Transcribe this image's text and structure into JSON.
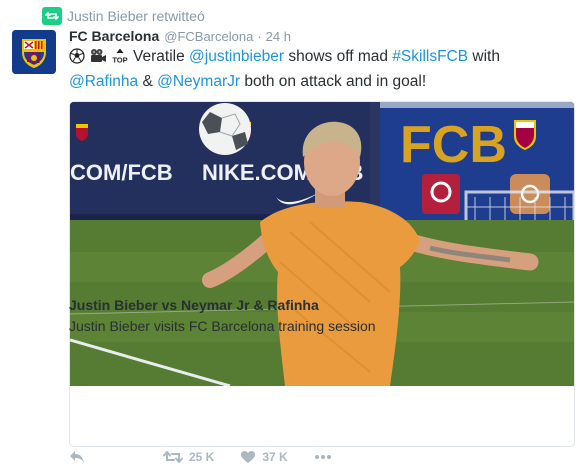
{
  "retweet": {
    "label": "Justin Bieber retwitteó"
  },
  "tweet": {
    "name": "FC Barcelona",
    "handle": "@FCBarcelona",
    "separator": "·",
    "time": "24 h",
    "emojis": [
      "soccer-ball-icon",
      "movie-camera-icon",
      "top-arrow-icon"
    ],
    "top_glyph": "TOP",
    "text_parts": {
      "p1": "Veratile ",
      "m1": "@justinbieber",
      "p2": " shows off mad ",
      "h1": "#SkillsFCB",
      "p3": " with ",
      "m2": "@Rafinha",
      "p4": " & ",
      "m3": "@NeymarJr",
      "p5": " both on attack and in goal!"
    }
  },
  "card": {
    "banner_left": "COM/FCB",
    "banner_mid": "NIKE.COM/FCB",
    "banner_right": "FCB",
    "title": "Justin Bieber vs Neymar Jr & Rafinha",
    "description": "Justin Bieber visits FC Barcelona training session"
  },
  "actions": {
    "retweets": "25 K",
    "likes": "37 K"
  },
  "colors": {
    "link": "#1b95e0",
    "retweet_green": "#19cf86",
    "muted": "#8899a6",
    "icon": "#aab8c2"
  }
}
